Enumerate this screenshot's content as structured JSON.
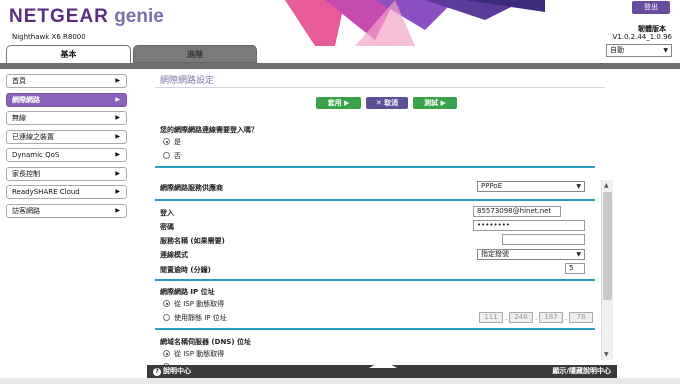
{
  "header": {
    "brand": "NETGEAR",
    "brand_suffix": "genie",
    "model": "Nighthawk X6 R8000",
    "logout": "登出",
    "firmware_label": "韌體版本",
    "firmware_version": "V1.0.2.44_1.0.96",
    "language": "自動"
  },
  "tabs": {
    "basic": "基本",
    "advanced": "進階"
  },
  "sidebar": {
    "items": [
      {
        "label": "首頁"
      },
      {
        "label": "網際網路"
      },
      {
        "label": "無線"
      },
      {
        "label": "已連線之裝置"
      },
      {
        "label": "Dynamic QoS"
      },
      {
        "label": "家長控制"
      },
      {
        "label": "ReadySHARE Cloud"
      },
      {
        "label": "訪客網路"
      }
    ]
  },
  "main": {
    "title": "網際網路設定",
    "buttons": {
      "apply": "套用 ▶",
      "cancel": "✕ 取消",
      "test": "測試 ▶"
    },
    "login_question": "您的網際網路連線需要登入嗎？",
    "opt_yes": "是",
    "opt_no": "否",
    "isp_label": "網際網路服務供應商",
    "isp_value": "PPPoE",
    "login_label": "登入",
    "login_value": "85573098@hinet.net",
    "password_label": "密碼",
    "password_value": "••••••••",
    "service_label": "服務名稱 (如果需要)",
    "service_value": "",
    "conn_mode_label": "連線模式",
    "conn_mode_value": "指定撥號",
    "idle_label": "閒置逾時 (分鐘)",
    "idle_value": "5",
    "ip_section": "網際網路 IP 位址",
    "ip_dynamic": "從 ISP 動態取得",
    "ip_static": "使用靜態 IP 位址",
    "ip_octets": [
      "111",
      "248",
      "187",
      "78"
    ],
    "dns_section": "網域名稱伺服器 (DNS) 位址",
    "dns_dynamic": "從 ISP 動態取得"
  },
  "footer": {
    "help": "說明中心",
    "show_help": "顯示/隱藏說明中心"
  },
  "colors": {
    "brand": "#5a2d82",
    "accent": "#8a63b8",
    "green": "#3aa24a",
    "teal": "#2b9bbc"
  }
}
